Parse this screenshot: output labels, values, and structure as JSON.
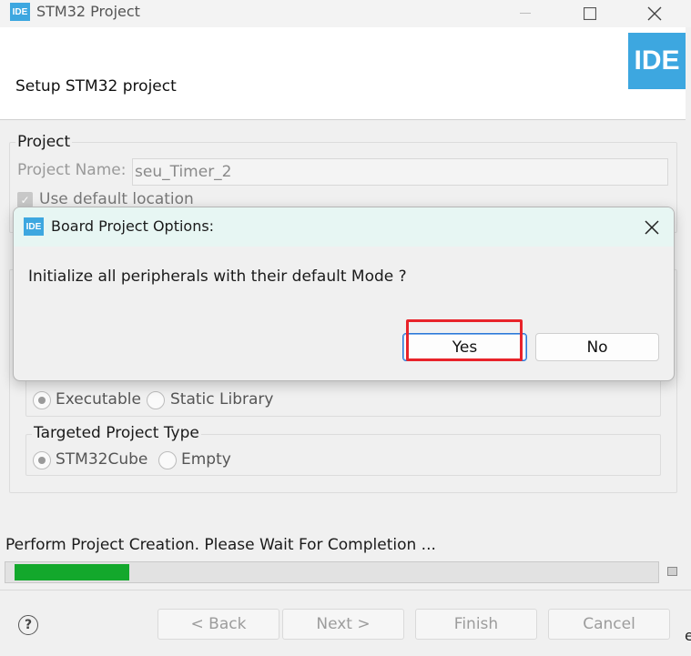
{
  "window": {
    "badge": "IDE",
    "title": "STM32 Project",
    "controls": {
      "minimize": "—",
      "maximize": "☐",
      "close": "✕"
    }
  },
  "header": {
    "heading": "Setup STM32 project",
    "logo_text": "IDE"
  },
  "project": {
    "group_title": "Project",
    "name_label": "Project Name:",
    "name_value": "seu_Timer_2",
    "use_default_location": "Use default location"
  },
  "binary_type": {
    "options": [
      "Executable",
      "Static Library"
    ],
    "selected": "Executable"
  },
  "project_type": {
    "group_title": "Targeted Project Type",
    "options": [
      "STM32Cube",
      "Empty"
    ],
    "selected": "STM32Cube"
  },
  "progress": {
    "status_text": "Perform Project Creation. Please Wait For Completion ...",
    "fraction": 0.18,
    "fill_color": "#13a82c"
  },
  "footer": {
    "help_symbol": "?",
    "back": "< Back",
    "next": "Next >",
    "finish": "Finish",
    "cancel": "Cancel",
    "edge_char": "e"
  },
  "dialog": {
    "badge": "IDE",
    "title": "Board Project Options:",
    "close": "✕",
    "message": "Initialize all peripherals with their default Mode ?",
    "yes": "Yes",
    "no": "No",
    "highlight_color": "#e8232a"
  },
  "colors": {
    "accent": "#3da7e0",
    "dialog_title_bg": "#e7f6f3"
  }
}
